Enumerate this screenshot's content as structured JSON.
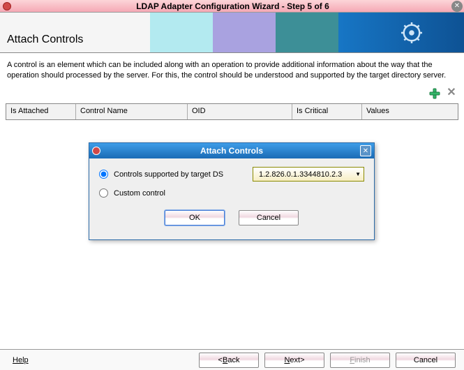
{
  "window": {
    "title": "LDAP Adapter Configuration Wizard - Step 5 of 6"
  },
  "header": {
    "title": "Attach Controls"
  },
  "description": "A control is an element which can be included along with an operation to provide additional information about the way that the operation should processed by the server. For this, the control should be understood and supported by the target directory server.",
  "table": {
    "columns": {
      "isAttached": "Is Attached",
      "controlName": "Control Name",
      "oid": "OID",
      "isCritical": "Is Critical",
      "values": "Values"
    }
  },
  "modal": {
    "title": "Attach Controls",
    "radio1": "Controls supported by target DS",
    "radio2": "Custom control",
    "selectedOid": "1.2.826.0.1.3344810.2.3",
    "ok": "OK",
    "cancel": "Cancel"
  },
  "footer": {
    "help": "Help",
    "back": "< Back",
    "next": "Next >",
    "finish": "Finish",
    "cancel": "Cancel"
  }
}
